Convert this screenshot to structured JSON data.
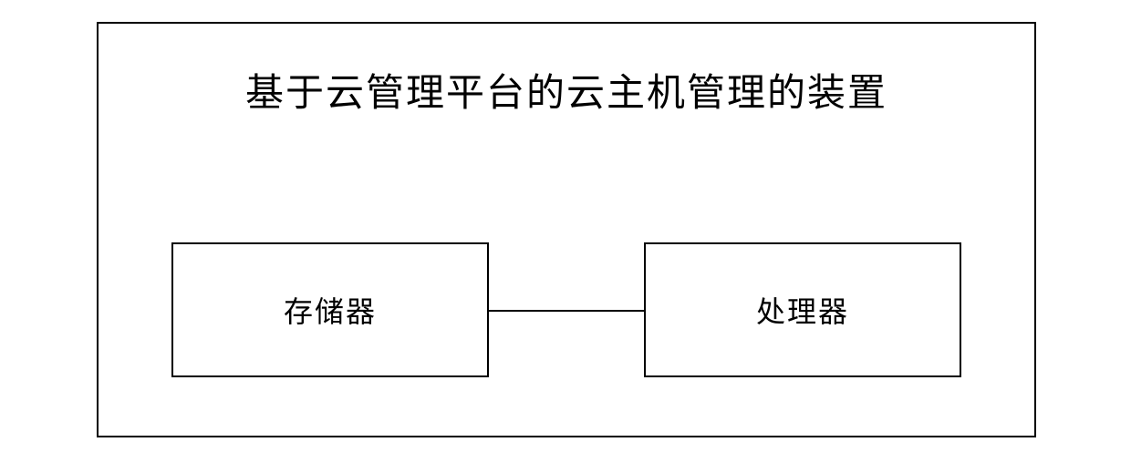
{
  "diagram": {
    "title": "基于云管理平台的云主机管理的装置",
    "blocks": {
      "left": {
        "label": "存储器"
      },
      "right": {
        "label": "处理器"
      }
    }
  }
}
